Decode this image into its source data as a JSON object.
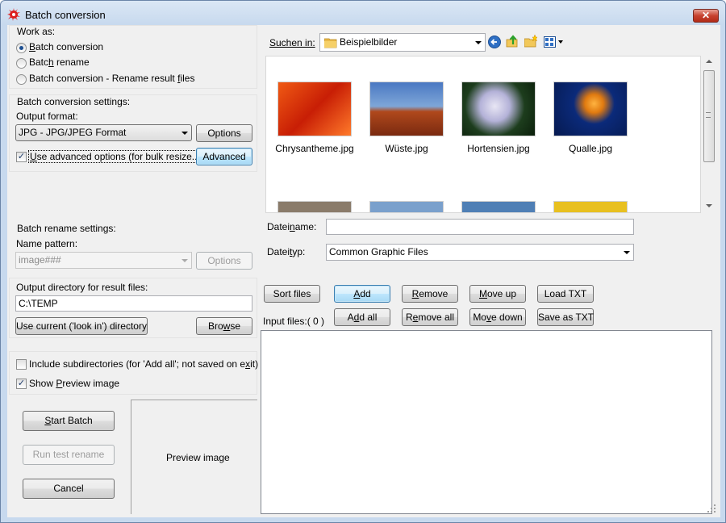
{
  "window": {
    "title": "Batch conversion",
    "close_label": "✕"
  },
  "work_as": {
    "label": "Work as:",
    "options": [
      {
        "pre": "",
        "u": "B",
        "post": "atch conversion",
        "selected": true
      },
      {
        "pre": "Batc",
        "u": "h",
        "post": " rename",
        "selected": false
      },
      {
        "pre": "Batch conversion - Rename result ",
        "u": "f",
        "post": "iles",
        "selected": false
      }
    ]
  },
  "conversion_settings": {
    "label": "Batch conversion settings:",
    "output_format_label": "Output format:",
    "output_format_value": "JPG - JPG/JPEG Format",
    "options_label": "Options",
    "advanced_check": {
      "pre": "",
      "u": "U",
      "post": "se advanced options (for bulk resize...)",
      "checked": true
    },
    "advanced_label": "Advanced"
  },
  "rename_settings": {
    "label": "Batch rename settings:",
    "pattern_label": "Name pattern:",
    "pattern_value": "image###",
    "options_label": "Options"
  },
  "output_dir": {
    "label": "Output directory for result files:",
    "value": "C:\\TEMP",
    "use_current_label": "Use current ('look in') directory",
    "browse_pre": "Bro",
    "browse_u": "w",
    "browse_post": "se"
  },
  "flags": {
    "include_subdirs": {
      "pre": "Include subdirectories (for 'Add all'; not saved on e",
      "u": "x",
      "post": "it)",
      "checked": false
    },
    "show_preview": {
      "pre": "Show ",
      "u": "P",
      "post": "review image",
      "checked": true
    }
  },
  "actions": {
    "start_pre": "",
    "start_u": "S",
    "start_post": "tart Batch",
    "test_rename": "Run test rename",
    "cancel": "Cancel"
  },
  "preview_text": "Preview image",
  "browser": {
    "look_in_label": "Suchen in:",
    "look_in_value": "Beispielbilder",
    "files": [
      {
        "name": "Chrysantheme.jpg",
        "bg": "linear-gradient(135deg,#f05a14,#c81e05,#ff7a2a)"
      },
      {
        "name": "Wüste.jpg",
        "bg": "linear-gradient(#4a78c2 0,#7ea6d8 45%,#b0481c 55%,#7a2a10 100%)"
      },
      {
        "name": "Hortensien.jpg",
        "bg": "radial-gradient(circle at 45% 45%,#e8e6f4 0,#b4b2d8 30%,#1d3d1d 60%,#0b1f0b 100%)"
      },
      {
        "name": "Qualle.jpg",
        "bg": "radial-gradient(circle at 55% 40%,#ffb340 0,#e07a10 18%,#0b2a7a 40%,#061a50 100%)"
      }
    ],
    "partial_colors": [
      "#8a7b6a",
      "#7aa0cc",
      "#4f7fb5",
      "#e8c020"
    ],
    "filename_label_pre": "Datei",
    "filename_label_u": "n",
    "filename_label_post": "ame:",
    "filename_value": "",
    "filetype_label_pre": "Datei",
    "filetype_label_u": "t",
    "filetype_label_post": "yp:",
    "filetype_value": "Common Graphic Files"
  },
  "list_buttons": {
    "sort": "Sort files",
    "add_pre": "",
    "add_u": "A",
    "add_post": "dd",
    "remove_pre": "",
    "remove_u": "R",
    "remove_post": "emove",
    "moveup_pre": "",
    "moveup_u": "M",
    "moveup_post": "ove up",
    "load": "Load TXT",
    "addall_pre": "A",
    "addall_u": "d",
    "addall_post": "d all",
    "removeall_pre": "R",
    "removeall_u": "e",
    "removeall_post": "move all",
    "movedown_pre": "Mo",
    "movedown_u": "v",
    "movedown_post": "e down",
    "save": "Save as TXT"
  },
  "input_files_label": "Input files:",
  "input_files_count": "( 0 )"
}
